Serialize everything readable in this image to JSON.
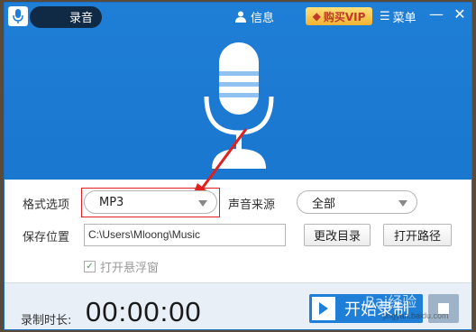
{
  "window": {
    "title": "录音",
    "menu_info": "信息",
    "vip_label": "购买VIP",
    "menu_label": "菜单",
    "minimize": "—",
    "close": "✕"
  },
  "format": {
    "label": "格式选项",
    "value": "MP3"
  },
  "source": {
    "label": "声音来源",
    "value": "全部"
  },
  "save": {
    "label": "保存位置",
    "path": "C:\\Users\\Mloong\\Music",
    "change_dir_button": "更改目录",
    "open_path_button": "打开路径"
  },
  "floating": {
    "label": "打开悬浮窗",
    "checked": true
  },
  "recording": {
    "duration_label": "录制时长:",
    "timer": "00:00:00",
    "start_button": "开始录制"
  },
  "watermark": {
    "text": "Bai经验",
    "sub": "jingyan.baidu.com"
  },
  "colors": {
    "accent": "#1f7ed6",
    "highlight": "#e02020"
  }
}
